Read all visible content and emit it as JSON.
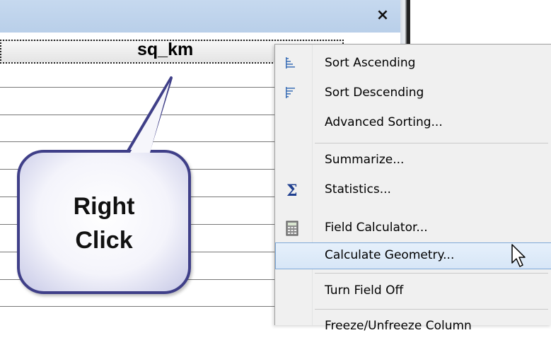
{
  "window": {
    "close_glyph": "×"
  },
  "table": {
    "column_header": "sq_km"
  },
  "callout": {
    "line1": "Right",
    "line2": "Click"
  },
  "context_menu": {
    "items": [
      {
        "label": "Sort Ascending",
        "icon": "sort-ascending-icon"
      },
      {
        "label": "Sort Descending",
        "icon": "sort-descending-icon"
      },
      {
        "label": "Advanced Sorting...",
        "icon": ""
      },
      {
        "label": "Summarize...",
        "icon": ""
      },
      {
        "label": "Statistics...",
        "icon": "sigma-icon"
      },
      {
        "label": "Field Calculator...",
        "icon": "calculator-icon"
      },
      {
        "label": "Calculate Geometry...",
        "icon": "",
        "highlighted": true
      },
      {
        "label": "Turn Field Off",
        "icon": ""
      },
      {
        "label": "Freeze/Unfreeze Column",
        "icon": ""
      }
    ]
  },
  "colors": {
    "highlight": "#d7e6f7",
    "callout_border": "#3f3f88",
    "titlebar": "#bed3ec"
  }
}
